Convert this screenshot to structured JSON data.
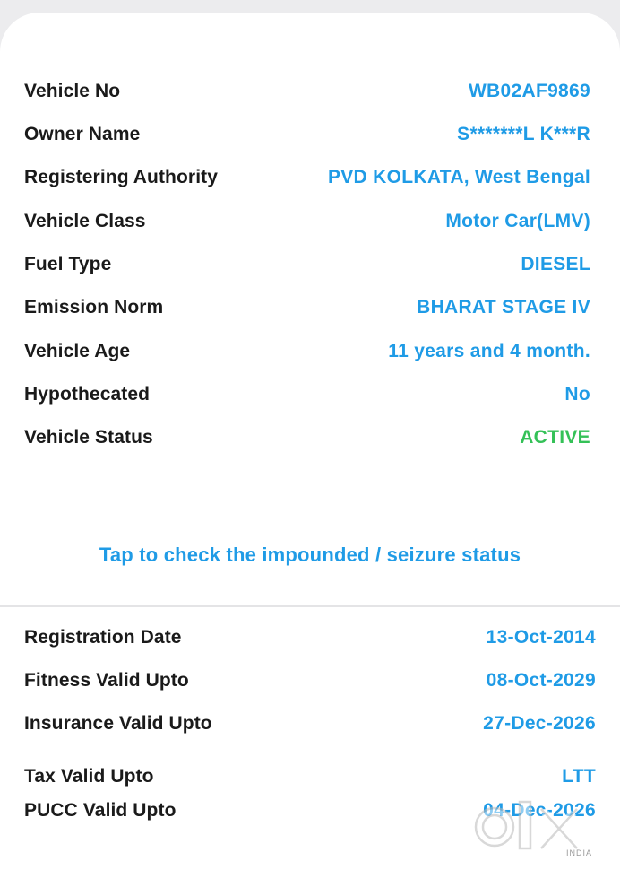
{
  "details": [
    {
      "label": "Vehicle No",
      "value": "WB02AF9869"
    },
    {
      "label": "Owner Name",
      "value": "S*******L K***R"
    },
    {
      "label": "Registering Authority",
      "value": "PVD KOLKATA, West Bengal"
    },
    {
      "label": "Vehicle Class",
      "value": "Motor Car(LMV)"
    },
    {
      "label": "Fuel Type",
      "value": "DIESEL"
    },
    {
      "label": "Emission Norm",
      "value": "BHARAT STAGE IV"
    },
    {
      "label": "Vehicle Age",
      "value": "11 years and 4 month."
    },
    {
      "label": "Hypothecated",
      "value": "No"
    },
    {
      "label": "Vehicle Status",
      "value": "ACTIVE"
    }
  ],
  "tap_link": "Tap to check the impounded / seizure status",
  "validity": [
    {
      "label": "Registration Date",
      "value": "13-Oct-2014"
    },
    {
      "label": "Fitness Valid Upto",
      "value": "08-Oct-2029"
    },
    {
      "label": "Insurance Valid Upto",
      "value": "27-Dec-2026"
    },
    {
      "label": "Tax Valid Upto",
      "value": "LTT"
    },
    {
      "label": "PUCC Valid Upto",
      "value": "04-Dec-2026"
    }
  ],
  "colors": {
    "value_blue": "#1f9be6",
    "status_active_green": "#34c157",
    "label_dark": "#1a1a1a"
  },
  "watermark": {
    "text": "INDIA",
    "icon": "olx-logo-icon"
  }
}
